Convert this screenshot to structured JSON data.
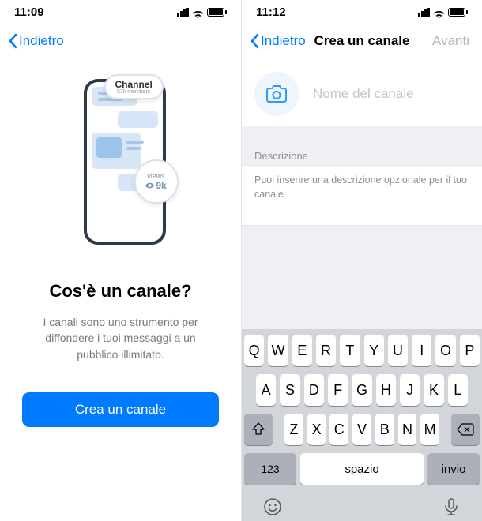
{
  "left": {
    "status": {
      "time": "11:09"
    },
    "nav": {
      "back": "Indietro"
    },
    "illus": {
      "badge_top_title": "Channel",
      "badge_top_sub": "57k members",
      "badge_side_label": "views",
      "badge_side_value": "9k"
    },
    "title": "Cos'è un canale?",
    "description": "I canali sono uno strumento per diffondere i tuoi messaggi a un pubblico illimitato.",
    "cta": "Crea un canale"
  },
  "right": {
    "status": {
      "time": "11:12"
    },
    "nav": {
      "back": "Indietro",
      "title": "Crea un canale",
      "next": "Avanti"
    },
    "form": {
      "name_placeholder": "Nome del canale",
      "desc_label": "Descrizione",
      "desc_help": "Puoi inserire una descrizione opzionale per il tuo canale."
    },
    "keyboard": {
      "row1": [
        "Q",
        "W",
        "E",
        "R",
        "T",
        "Y",
        "U",
        "I",
        "O",
        "P"
      ],
      "row2": [
        "A",
        "S",
        "D",
        "F",
        "G",
        "H",
        "J",
        "K",
        "L"
      ],
      "row3": [
        "Z",
        "X",
        "C",
        "V",
        "B",
        "N",
        "M"
      ],
      "numbers": "123",
      "space": "spazio",
      "enter": "invio"
    }
  }
}
